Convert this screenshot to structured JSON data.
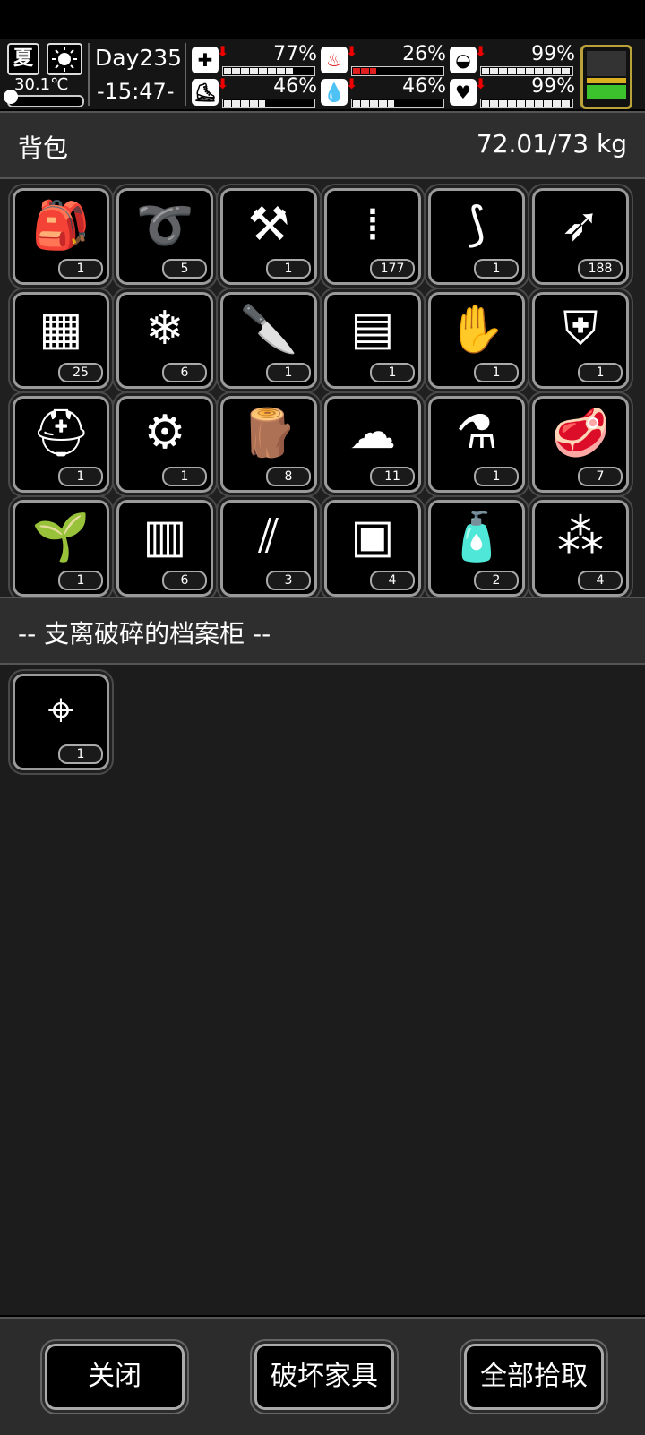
{
  "hud": {
    "season": "夏",
    "weather_icon": "sun-icon",
    "temperature": "30.1℃",
    "day": "Day235",
    "clock": "-15:47-",
    "stats": [
      {
        "name": "health",
        "icon": "medkit-icon",
        "glyph": "✚",
        "trend": "down",
        "value": "77%",
        "level": 0.77
      },
      {
        "name": "hunger",
        "icon": "stomach-icon",
        "glyph": "♨",
        "trend": "down",
        "value": "26%",
        "level": 0.26,
        "color": "#e02020"
      },
      {
        "name": "medicine",
        "icon": "pill-icon",
        "glyph": "◒",
        "trend": "down",
        "value": "99%",
        "level": 0.99
      },
      {
        "name": "stamina",
        "icon": "boot-icon",
        "glyph": "⛸",
        "trend": "down",
        "value": "46%",
        "level": 0.46
      },
      {
        "name": "thirst",
        "icon": "water-drop-icon",
        "glyph": "💧",
        "trend": "down",
        "value": "46%",
        "level": 0.46
      },
      {
        "name": "mood",
        "icon": "heart-icon",
        "glyph": "♥",
        "trend": "down",
        "value": "99%",
        "level": 0.99
      }
    ],
    "battery_icon": "battery-icon"
  },
  "backpack": {
    "title": "背包",
    "weight": "72.01/73 kg",
    "items": [
      {
        "icon": "backpack-icon",
        "glyph": "🎒",
        "count": "1"
      },
      {
        "icon": "rope-icon",
        "glyph": "➰",
        "count": "5"
      },
      {
        "icon": "shovel-icon",
        "glyph": "⚒",
        "count": "1"
      },
      {
        "icon": "bullets-icon",
        "glyph": "⁞",
        "count": "177"
      },
      {
        "icon": "compound-bow-icon",
        "glyph": "⟆",
        "count": "1"
      },
      {
        "icon": "arrow-icon",
        "glyph": "➶",
        "count": "188"
      },
      {
        "icon": "net-icon",
        "glyph": "▦",
        "count": "25"
      },
      {
        "icon": "ice-icon",
        "glyph": "❄",
        "count": "6"
      },
      {
        "icon": "knife-icon",
        "glyph": "🔪",
        "count": "1"
      },
      {
        "icon": "armor-plate-icon",
        "glyph": "▤",
        "count": "1"
      },
      {
        "icon": "gloves-icon",
        "glyph": "✋",
        "count": "1"
      },
      {
        "icon": "body-armor-icon",
        "glyph": "⛨",
        "count": "1"
      },
      {
        "icon": "helmet-icon",
        "glyph": "⛑",
        "count": "1"
      },
      {
        "icon": "minigun-icon",
        "glyph": "⚙",
        "count": "1"
      },
      {
        "icon": "logs-icon",
        "glyph": "🪵",
        "count": "8"
      },
      {
        "icon": "cloth-icon",
        "glyph": "☁",
        "count": "11"
      },
      {
        "icon": "test-tube-icon",
        "glyph": "⚗",
        "count": "1"
      },
      {
        "icon": "meat-icon",
        "glyph": "🥩",
        "count": "7"
      },
      {
        "icon": "sprout-soil-icon",
        "glyph": "🌱",
        "count": "1"
      },
      {
        "icon": "wood-blocks-icon",
        "glyph": "▥",
        "count": "6"
      },
      {
        "icon": "planks-icon",
        "glyph": "⫽",
        "count": "3"
      },
      {
        "icon": "bricks-icon",
        "glyph": "▣",
        "count": "4"
      },
      {
        "icon": "water-bottle-icon",
        "glyph": "🧴",
        "count": "2"
      },
      {
        "icon": "rubble-icon",
        "glyph": "⁂",
        "count": "4"
      }
    ]
  },
  "container": {
    "title": "-- 支离破碎的档案柜 --",
    "items": [
      {
        "icon": "sniper-rifle-icon",
        "glyph": "⌖",
        "count": "1"
      }
    ]
  },
  "buttons": {
    "close": "关闭",
    "destroy": "破坏家具",
    "take_all": "全部拾取"
  }
}
